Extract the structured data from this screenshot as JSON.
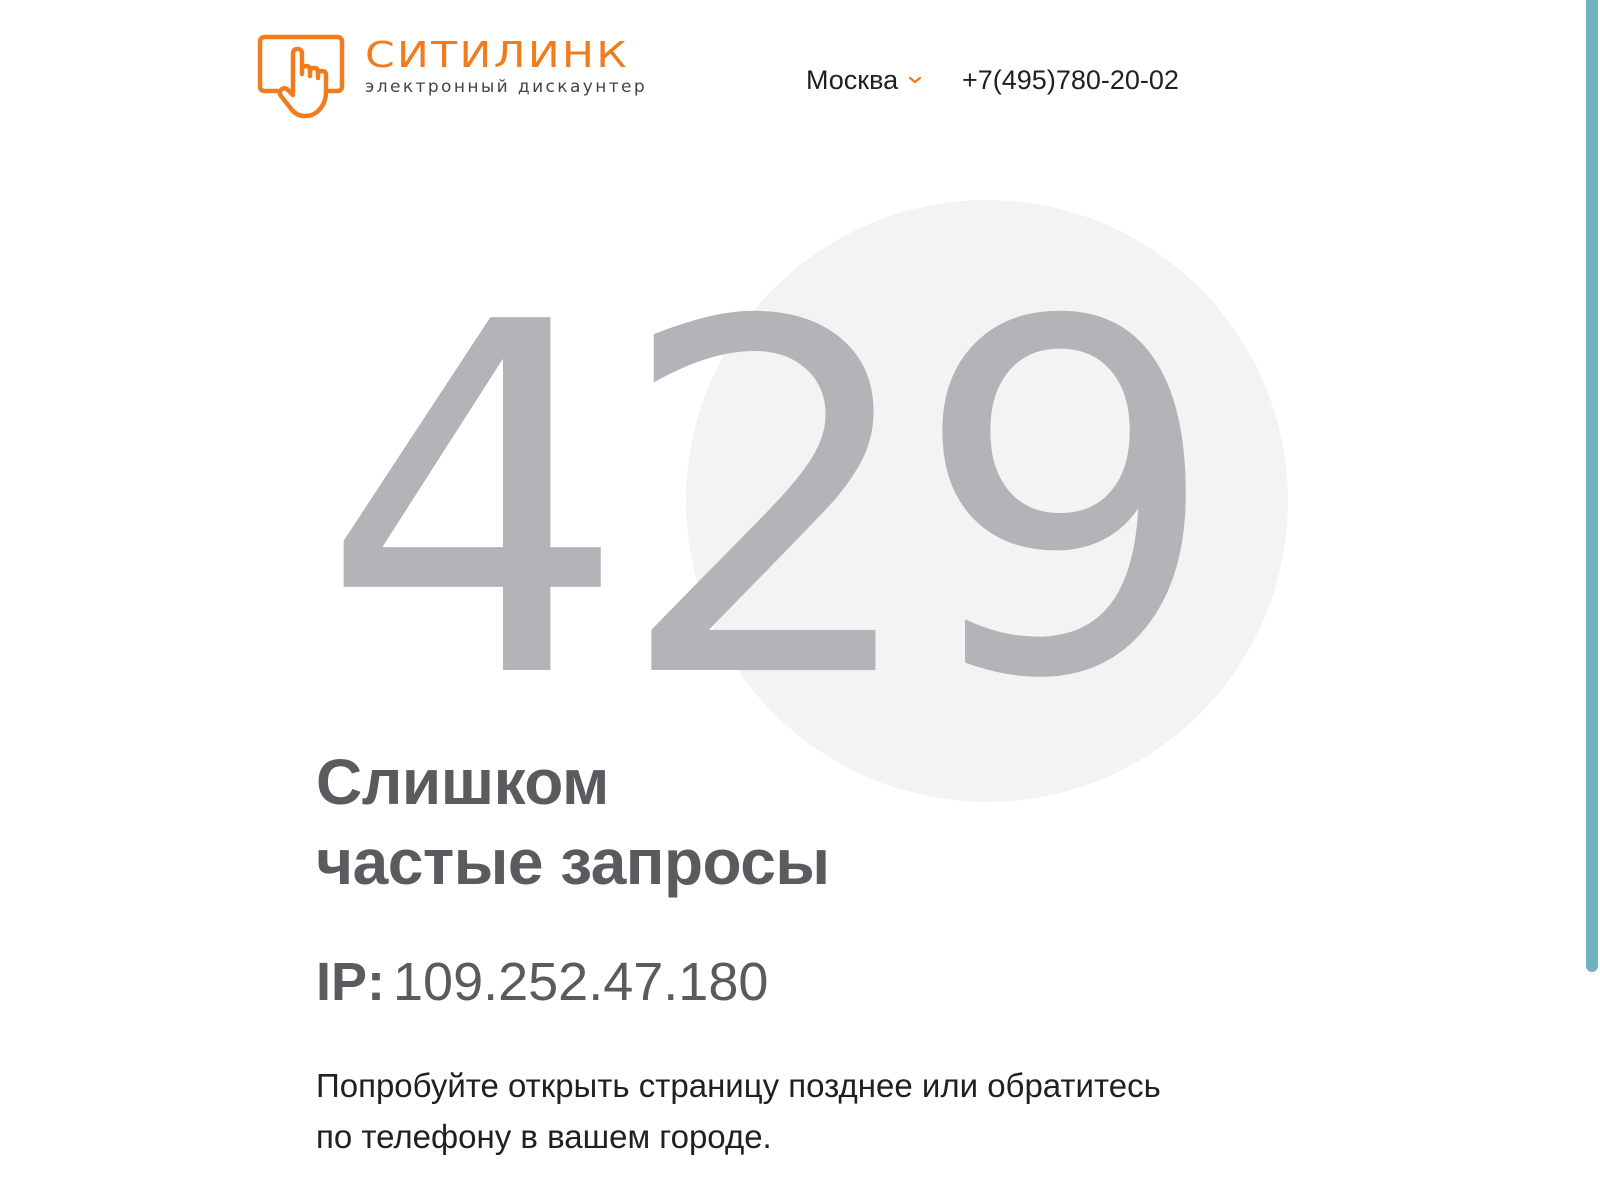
{
  "header": {
    "logo": {
      "name": "СИТИЛИНК",
      "tagline": "электронный дискаунтер",
      "icon": "hand-pointer-screen-icon",
      "brand_color": "#f07c1e"
    },
    "city": {
      "selected": "Москва",
      "icon": "chevron-down-icon"
    },
    "phone": "+7(495)780-20-02"
  },
  "error": {
    "code": "429",
    "title_line1": "Слишком",
    "title_line2": "частые запросы",
    "ip_label": "IP:",
    "ip_value": "109.252.47.180",
    "message_line1": "Попробуйте открыть страницу позднее или обратитесь",
    "message_line2": "по телефону в вашем городе."
  },
  "colors": {
    "accent": "#f07c1e",
    "code_gray": "#b3b3b7",
    "circle_bg": "#f3f3f3",
    "heading_gray": "#5a5a5f",
    "text_dark": "#1f1f24",
    "scrollbar": "#6fb3c1"
  }
}
